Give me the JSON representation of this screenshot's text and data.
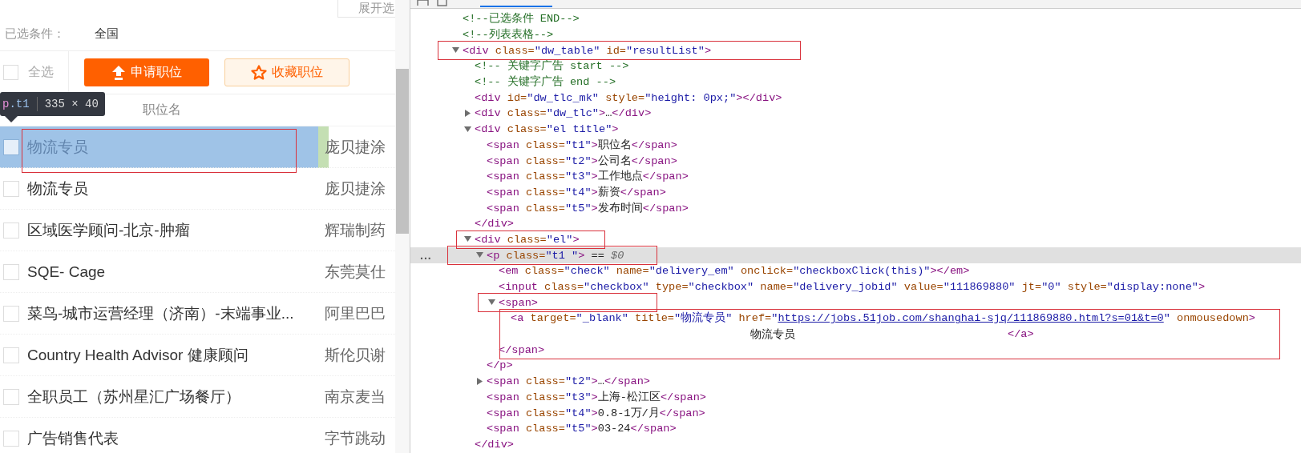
{
  "job_list": {
    "expand_button": "展开选",
    "filter_label": "已选条件：",
    "filter_value": "全国",
    "select_all": {
      "label": "全选",
      "checked": false
    },
    "actions": [
      {
        "kind": "apply",
        "label": "申请职位"
      },
      {
        "kind": "favorite",
        "label": "收藏职位"
      }
    ],
    "column_header": "职位名",
    "rows": [
      {
        "title": "物流专员",
        "company": "庞贝捷涂",
        "checked": false,
        "highlighted": true
      },
      {
        "title": "物流专员",
        "company": "庞贝捷涂",
        "checked": false,
        "highlighted": false
      },
      {
        "title": "区域医学顾问-北京-肿瘤",
        "company": "辉瑞制药",
        "checked": false,
        "highlighted": false
      },
      {
        "title": "SQE- Cage",
        "company": "东莞莫仕",
        "checked": false,
        "highlighted": false
      },
      {
        "title": "菜鸟-城市运营经理（济南）-末端事业...",
        "company": "阿里巴巴",
        "checked": false,
        "highlighted": false
      },
      {
        "title": "Country Health Advisor 健康顾问",
        "company": "斯伦贝谢",
        "checked": false,
        "highlighted": false
      },
      {
        "title": "全职员工（苏州星汇广场餐厅）",
        "company": "南京麦当",
        "checked": false,
        "highlighted": false
      },
      {
        "title": "广告销售代表",
        "company": "字节跳动",
        "checked": false,
        "highlighted": false
      }
    ]
  },
  "inspect_tooltip": {
    "tag": "p",
    "class_name": ".t1",
    "size": "335 × 40"
  },
  "devtools": {
    "selected_marker": "...",
    "tree": [
      {
        "selected": false,
        "tokens": [
          {
            "kind": "comment",
            "text": "<!--已选条件 END-->"
          }
        ]
      },
      {
        "selected": false,
        "tokens": [
          {
            "kind": "comment",
            "text": "<!--列表表格-->"
          }
        ]
      },
      {
        "selected": false,
        "expanded": true,
        "tokens": [
          {
            "kind": "tag",
            "text": "<div"
          },
          {
            "kind": "attr",
            "text": " class="
          },
          {
            "kind": "value",
            "text": "\"dw_table\""
          },
          {
            "kind": "attr",
            "text": " id="
          },
          {
            "kind": "value",
            "text": "\"resultList\""
          },
          {
            "kind": "tag",
            "text": ">"
          }
        ],
        "children": [
          {
            "selected": false,
            "tokens": [
              {
                "kind": "comment",
                "text": "<!-- 关键字广告 start -->"
              }
            ]
          },
          {
            "selected": false,
            "tokens": [
              {
                "kind": "comment",
                "text": "<!-- 关键字广告 end -->"
              }
            ]
          },
          {
            "selected": false,
            "tokens": [
              {
                "kind": "tag",
                "text": "<div"
              },
              {
                "kind": "attr",
                "text": " id="
              },
              {
                "kind": "value",
                "text": "\"dw_tlc_mk\""
              },
              {
                "kind": "attr",
                "text": " style="
              },
              {
                "kind": "value",
                "text": "\"height: 0px;\""
              },
              {
                "kind": "tag",
                "text": "></div>"
              }
            ]
          },
          {
            "selected": false,
            "expanded": false,
            "tokens": [
              {
                "kind": "tag",
                "text": "<div"
              },
              {
                "kind": "attr",
                "text": " class="
              },
              {
                "kind": "value",
                "text": "\"dw_tlc\""
              },
              {
                "kind": "tag",
                "text": ">"
              },
              {
                "kind": "text",
                "text": "…"
              },
              {
                "kind": "tag",
                "text": "</div>"
              }
            ]
          },
          {
            "selected": false,
            "expanded": true,
            "tokens": [
              {
                "kind": "tag",
                "text": "<div"
              },
              {
                "kind": "attr",
                "text": " class="
              },
              {
                "kind": "value",
                "text": "\"el title\""
              },
              {
                "kind": "tag",
                "text": ">"
              }
            ],
            "children": [
              {
                "selected": false,
                "tokens": [
                  {
                    "kind": "tag",
                    "text": "<span"
                  },
                  {
                    "kind": "attr",
                    "text": " class="
                  },
                  {
                    "kind": "value",
                    "text": "\"t1\""
                  },
                  {
                    "kind": "tag",
                    "text": ">"
                  },
                  {
                    "kind": "text",
                    "text": "职位名"
                  },
                  {
                    "kind": "tag",
                    "text": "</span>"
                  }
                ]
              },
              {
                "selected": false,
                "tokens": [
                  {
                    "kind": "tag",
                    "text": "<span"
                  },
                  {
                    "kind": "attr",
                    "text": " class="
                  },
                  {
                    "kind": "value",
                    "text": "\"t2\""
                  },
                  {
                    "kind": "tag",
                    "text": ">"
                  },
                  {
                    "kind": "text",
                    "text": "公司名"
                  },
                  {
                    "kind": "tag",
                    "text": "</span>"
                  }
                ]
              },
              {
                "selected": false,
                "tokens": [
                  {
                    "kind": "tag",
                    "text": "<span"
                  },
                  {
                    "kind": "attr",
                    "text": " class="
                  },
                  {
                    "kind": "value",
                    "text": "\"t3\""
                  },
                  {
                    "kind": "tag",
                    "text": ">"
                  },
                  {
                    "kind": "text",
                    "text": "工作地点"
                  },
                  {
                    "kind": "tag",
                    "text": "</span>"
                  }
                ]
              },
              {
                "selected": false,
                "tokens": [
                  {
                    "kind": "tag",
                    "text": "<span"
                  },
                  {
                    "kind": "attr",
                    "text": " class="
                  },
                  {
                    "kind": "value",
                    "text": "\"t4\""
                  },
                  {
                    "kind": "tag",
                    "text": ">"
                  },
                  {
                    "kind": "text",
                    "text": "薪资"
                  },
                  {
                    "kind": "tag",
                    "text": "</span>"
                  }
                ]
              },
              {
                "selected": false,
                "tokens": [
                  {
                    "kind": "tag",
                    "text": "<span"
                  },
                  {
                    "kind": "attr",
                    "text": " class="
                  },
                  {
                    "kind": "value",
                    "text": "\"t5\""
                  },
                  {
                    "kind": "tag",
                    "text": ">"
                  },
                  {
                    "kind": "text",
                    "text": "发布时间"
                  },
                  {
                    "kind": "tag",
                    "text": "</span>"
                  }
                ]
              }
            ],
            "close": [
              {
                "kind": "tag",
                "text": "</div>"
              }
            ]
          },
          {
            "selected": false,
            "expanded": true,
            "tokens": [
              {
                "kind": "tag",
                "text": "<div"
              },
              {
                "kind": "attr",
                "text": " class="
              },
              {
                "kind": "value",
                "text": "\"el\""
              },
              {
                "kind": "tag",
                "text": ">"
              }
            ],
            "children": [
              {
                "selected": true,
                "expanded": true,
                "tokens": [
                  {
                    "kind": "tag",
                    "text": "<p"
                  },
                  {
                    "kind": "attr",
                    "text": " class="
                  },
                  {
                    "kind": "value",
                    "text": "\"t1 \""
                  },
                  {
                    "kind": "tag",
                    "text": ">"
                  },
                  {
                    "kind": "eq",
                    "text": " == "
                  },
                  {
                    "kind": "var",
                    "text": "$0"
                  }
                ],
                "children": [
                  {
                    "selected": false,
                    "tokens": [
                      {
                        "kind": "tag",
                        "text": "<em"
                      },
                      {
                        "kind": "attr",
                        "text": " class="
                      },
                      {
                        "kind": "value",
                        "text": "\"check\""
                      },
                      {
                        "kind": "attr",
                        "text": " name="
                      },
                      {
                        "kind": "value",
                        "text": "\"delivery_em\""
                      },
                      {
                        "kind": "attr",
                        "text": " onclick="
                      },
                      {
                        "kind": "value",
                        "text": "\"checkboxClick(this)\""
                      },
                      {
                        "kind": "tag",
                        "text": "></em>"
                      }
                    ]
                  },
                  {
                    "selected": false,
                    "tokens": [
                      {
                        "kind": "tag",
                        "text": "<input"
                      },
                      {
                        "kind": "attr",
                        "text": " class="
                      },
                      {
                        "kind": "value",
                        "text": "\"checkbox\""
                      },
                      {
                        "kind": "attr",
                        "text": " type="
                      },
                      {
                        "kind": "value",
                        "text": "\"checkbox\""
                      },
                      {
                        "kind": "attr",
                        "text": " name="
                      },
                      {
                        "kind": "value",
                        "text": "\"delivery_jobid\""
                      },
                      {
                        "kind": "attr",
                        "text": " value="
                      },
                      {
                        "kind": "value",
                        "text": "\"111869880\""
                      },
                      {
                        "kind": "attr",
                        "text": " jt="
                      },
                      {
                        "kind": "value",
                        "text": "\"0\""
                      },
                      {
                        "kind": "attr",
                        "text": " style="
                      },
                      {
                        "kind": "value",
                        "text": "\"display:none\""
                      },
                      {
                        "kind": "tag",
                        "text": ">"
                      }
                    ]
                  },
                  {
                    "selected": false,
                    "expanded": true,
                    "tokens": [
                      {
                        "kind": "tag",
                        "text": "<span>"
                      }
                    ],
                    "children": [
                      {
                        "selected": false,
                        "tokens": [
                          {
                            "kind": "tag",
                            "text": "<a"
                          },
                          {
                            "kind": "attr",
                            "text": " target="
                          },
                          {
                            "kind": "value",
                            "text": "\"_blank\""
                          },
                          {
                            "kind": "attr",
                            "text": " title="
                          },
                          {
                            "kind": "value",
                            "text": "\"物流专员\""
                          },
                          {
                            "kind": "attr",
                            "text": " href="
                          },
                          {
                            "kind": "value",
                            "text": "\""
                          },
                          {
                            "kind": "link",
                            "text": "https://jobs.51job.com/shanghai-sjq/111869880.html?s=01&t=0"
                          },
                          {
                            "kind": "value",
                            "text": "\""
                          },
                          {
                            "kind": "attr",
                            "text": " onmousedown"
                          },
                          {
                            "kind": "tag",
                            "text": ">"
                          }
                        ],
                        "continuation": [
                          {
                            "kind": "text",
                            "text": "物流专员"
                          },
                          {
                            "kind": "tag",
                            "text": "</a>"
                          }
                        ]
                      }
                    ],
                    "close": [
                      {
                        "kind": "tag",
                        "text": "</span>"
                      }
                    ]
                  }
                ],
                "close": [
                  {
                    "kind": "tag",
                    "text": "</p>"
                  }
                ]
              },
              {
                "selected": false,
                "expanded": false,
                "tokens": [
                  {
                    "kind": "tag",
                    "text": "<span"
                  },
                  {
                    "kind": "attr",
                    "text": " class="
                  },
                  {
                    "kind": "value",
                    "text": "\"t2\""
                  },
                  {
                    "kind": "tag",
                    "text": ">"
                  },
                  {
                    "kind": "text",
                    "text": "…"
                  },
                  {
                    "kind": "tag",
                    "text": "</span>"
                  }
                ]
              },
              {
                "selected": false,
                "tokens": [
                  {
                    "kind": "tag",
                    "text": "<span"
                  },
                  {
                    "kind": "attr",
                    "text": " class="
                  },
                  {
                    "kind": "value",
                    "text": "\"t3\""
                  },
                  {
                    "kind": "tag",
                    "text": ">"
                  },
                  {
                    "kind": "text",
                    "text": "上海-松江区"
                  },
                  {
                    "kind": "tag",
                    "text": "</span>"
                  }
                ]
              },
              {
                "selected": false,
                "tokens": [
                  {
                    "kind": "tag",
                    "text": "<span"
                  },
                  {
                    "kind": "attr",
                    "text": " class="
                  },
                  {
                    "kind": "value",
                    "text": "\"t4\""
                  },
                  {
                    "kind": "tag",
                    "text": ">"
                  },
                  {
                    "kind": "text",
                    "text": "0.8-1万/月"
                  },
                  {
                    "kind": "tag",
                    "text": "</span>"
                  }
                ]
              },
              {
                "selected": false,
                "tokens": [
                  {
                    "kind": "tag",
                    "text": "<span"
                  },
                  {
                    "kind": "attr",
                    "text": " class="
                  },
                  {
                    "kind": "value",
                    "text": "\"t5\""
                  },
                  {
                    "kind": "tag",
                    "text": ">"
                  },
                  {
                    "kind": "text",
                    "text": "03-24"
                  },
                  {
                    "kind": "tag",
                    "text": "</span>"
                  }
                ]
              }
            ],
            "close": [
              {
                "kind": "tag",
                "text": "</div>"
              }
            ]
          }
        ]
      }
    ]
  }
}
